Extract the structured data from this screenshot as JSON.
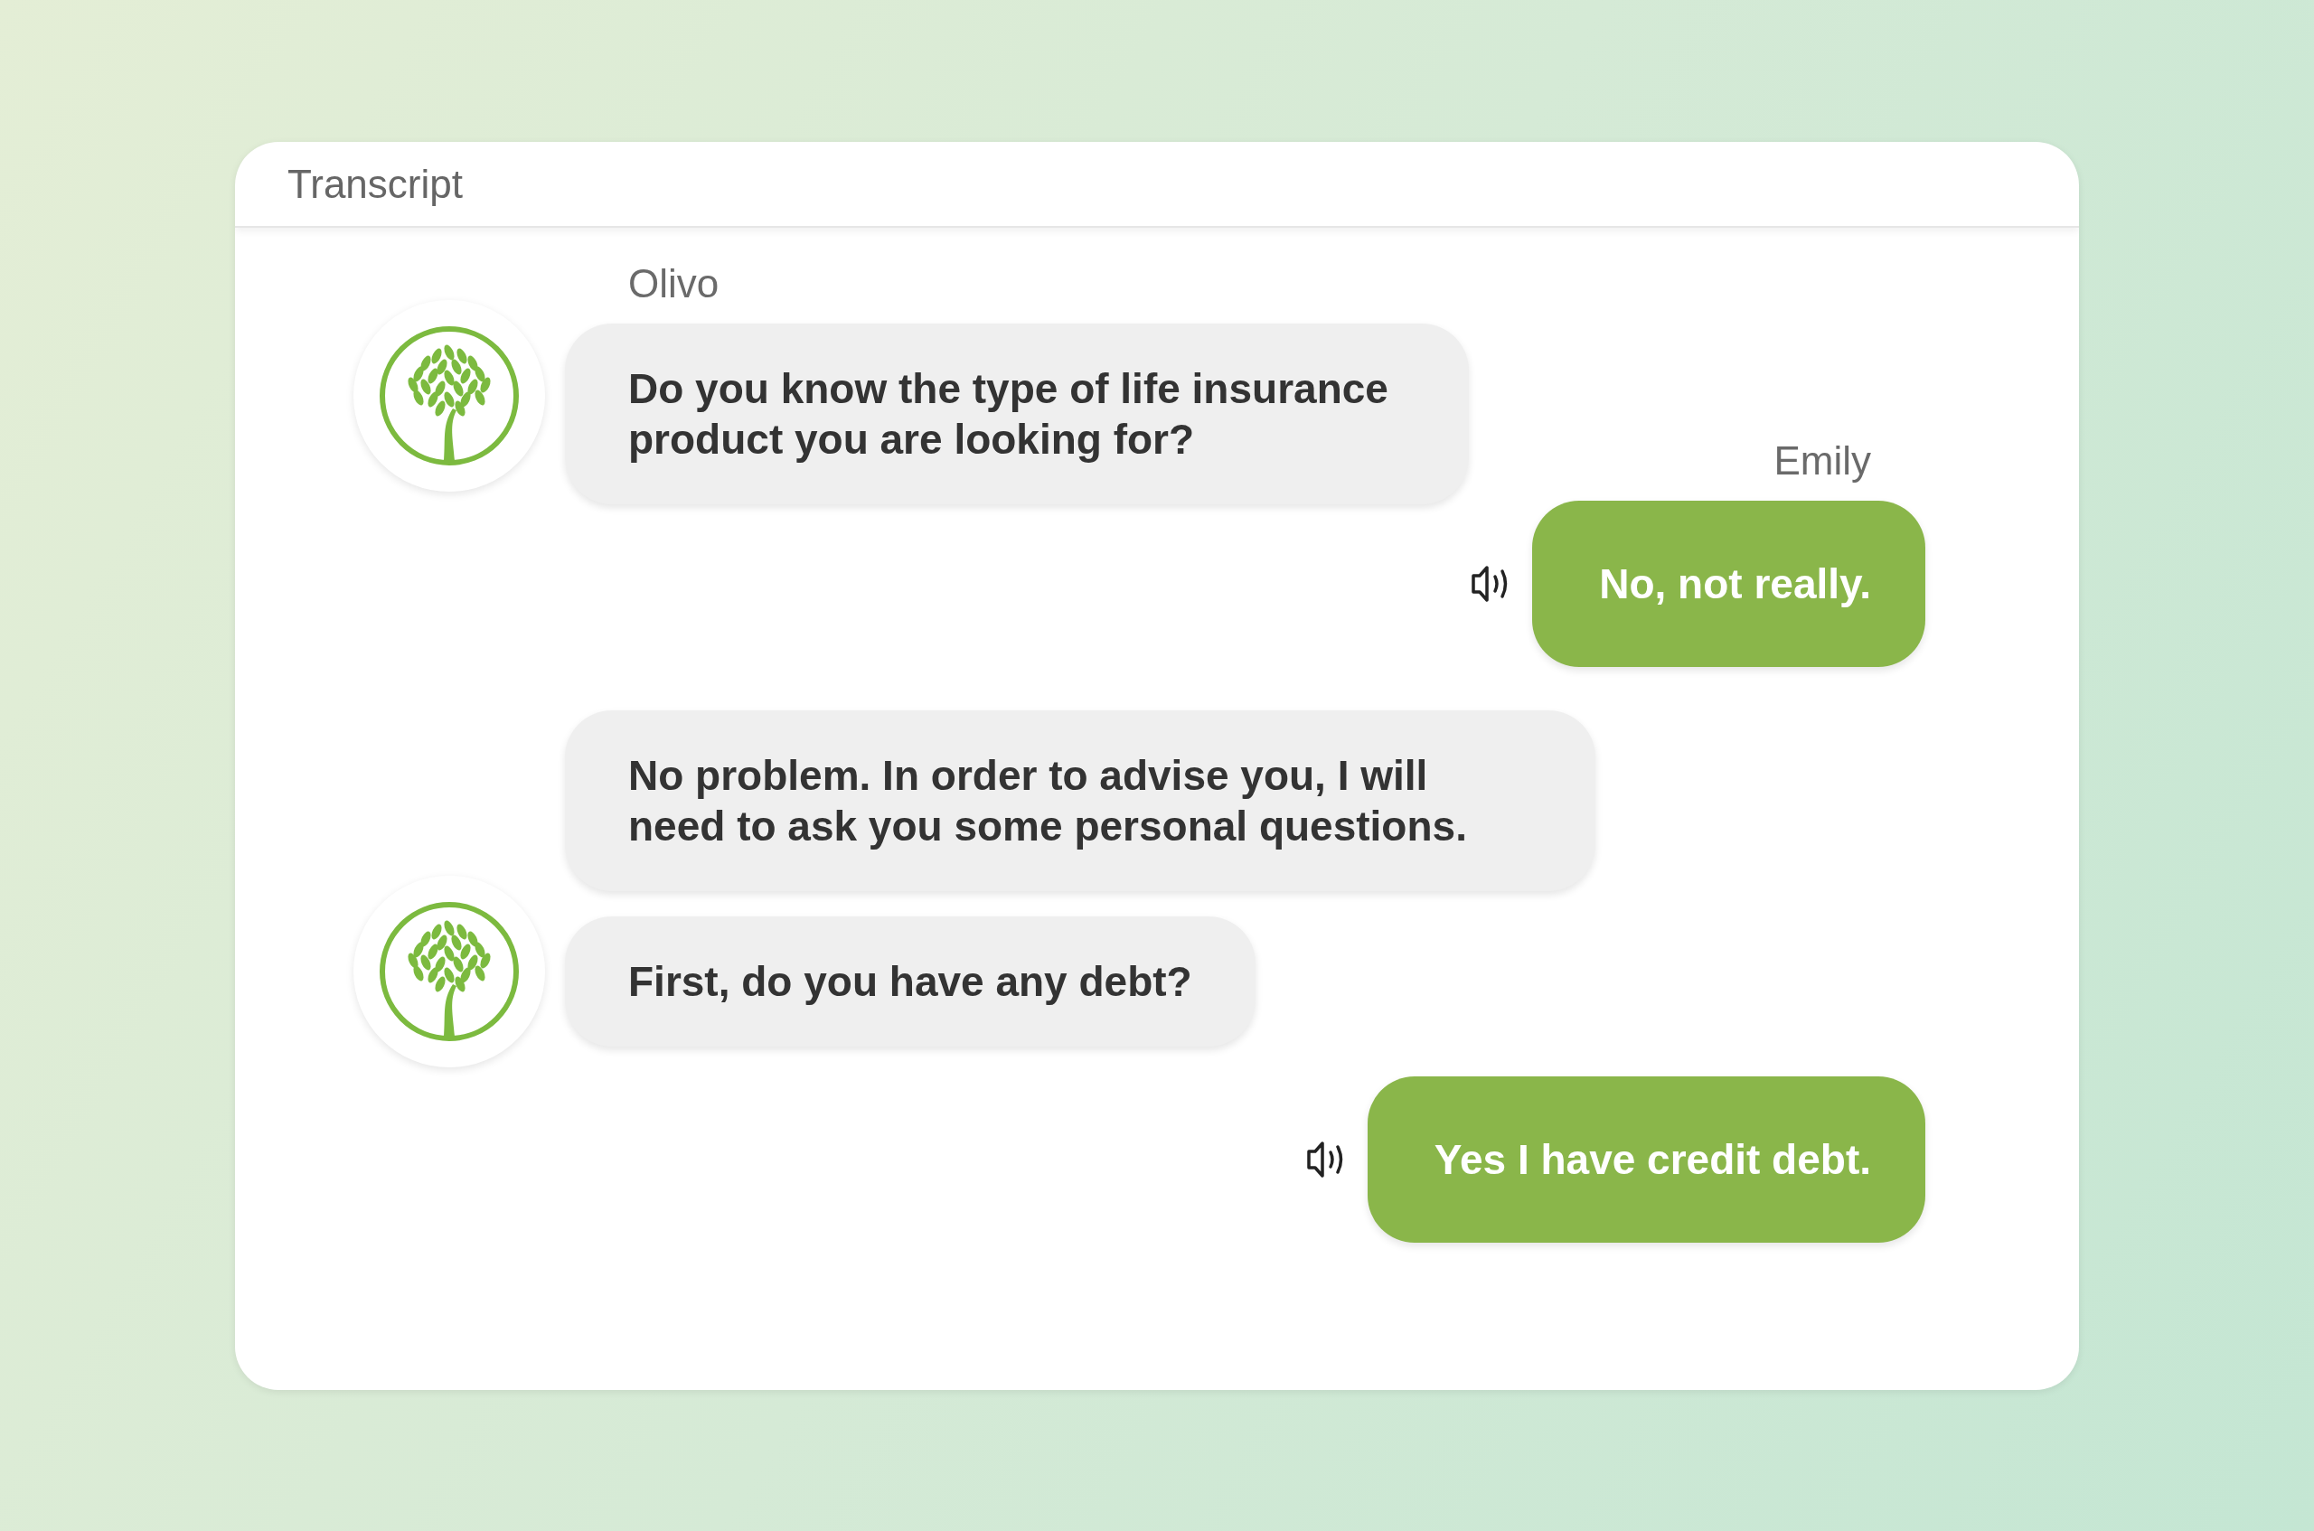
{
  "panel": {
    "title": "Transcript"
  },
  "messages": [
    {
      "kind": "bot",
      "sender": "Olivo",
      "avatar": true,
      "text": "Do you know the type of life insurance product you are looking for?"
    },
    {
      "kind": "user",
      "sender": "Emily",
      "text": "No, not really."
    },
    {
      "kind": "bot",
      "avatar": false,
      "text": "No problem. In order to advise you, I will need to ask you some personal questions."
    },
    {
      "kind": "bot",
      "avatar": true,
      "text": "First, do you have any debt?"
    },
    {
      "kind": "user",
      "text": "Yes I have credit debt."
    }
  ]
}
